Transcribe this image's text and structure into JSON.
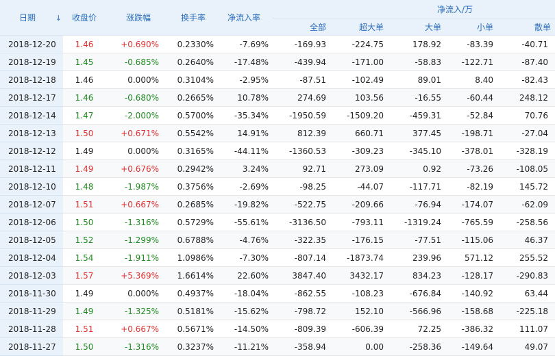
{
  "header": {
    "date": "日期",
    "sort_icon": "↓",
    "close": "收盘价",
    "change": "涨跌幅",
    "turnover": "换手率",
    "net_ratio": "净流入率",
    "flow_group": "净流入/万",
    "total": "全部",
    "xl": "超大单",
    "large": "大单",
    "small": "小单",
    "retail": "散单"
  },
  "colors": {
    "up": "#e03030",
    "down": "#1f8a1f",
    "header_text": "#2a6dbd",
    "header_bg": "#e9f2fb"
  },
  "rows": [
    {
      "date": "2018-12-20",
      "close": "1.46",
      "change": "+0.690%",
      "dir": "up",
      "turnover": "0.2330%",
      "net_ratio": "-7.69%",
      "total": "-169.93",
      "xl": "-224.75",
      "large": "178.92",
      "small": "-83.39",
      "retail": "-40.71"
    },
    {
      "date": "2018-12-19",
      "close": "1.45",
      "change": "-0.685%",
      "dir": "down",
      "turnover": "0.2640%",
      "net_ratio": "-17.48%",
      "total": "-439.94",
      "xl": "-171.00",
      "large": "-58.83",
      "small": "-122.71",
      "retail": "-87.40"
    },
    {
      "date": "2018-12-18",
      "close": "1.46",
      "change": "0.000%",
      "dir": "flat",
      "turnover": "0.3104%",
      "net_ratio": "-2.95%",
      "total": "-87.51",
      "xl": "-102.49",
      "large": "89.01",
      "small": "8.40",
      "retail": "-82.43"
    },
    {
      "date": "2018-12-17",
      "close": "1.46",
      "change": "-0.680%",
      "dir": "down",
      "turnover": "0.2665%",
      "net_ratio": "10.78%",
      "total": "274.69",
      "xl": "103.56",
      "large": "-16.55",
      "small": "-60.44",
      "retail": "248.12"
    },
    {
      "date": "2018-12-14",
      "close": "1.47",
      "change": "-2.000%",
      "dir": "down",
      "turnover": "0.5700%",
      "net_ratio": "-35.34%",
      "total": "-1950.59",
      "xl": "-1509.20",
      "large": "-459.31",
      "small": "-52.84",
      "retail": "70.76"
    },
    {
      "date": "2018-12-13",
      "close": "1.50",
      "change": "+0.671%",
      "dir": "up",
      "turnover": "0.5542%",
      "net_ratio": "14.91%",
      "total": "812.39",
      "xl": "660.71",
      "large": "377.45",
      "small": "-198.71",
      "retail": "-27.04"
    },
    {
      "date": "2018-12-12",
      "close": "1.49",
      "change": "0.000%",
      "dir": "flat",
      "turnover": "0.3165%",
      "net_ratio": "-44.11%",
      "total": "-1360.53",
      "xl": "-309.23",
      "large": "-345.10",
      "small": "-378.01",
      "retail": "-328.19"
    },
    {
      "date": "2018-12-11",
      "close": "1.49",
      "change": "+0.676%",
      "dir": "up",
      "turnover": "0.2942%",
      "net_ratio": "3.24%",
      "total": "92.71",
      "xl": "273.09",
      "large": "0.92",
      "small": "-73.26",
      "retail": "-108.05"
    },
    {
      "date": "2018-12-10",
      "close": "1.48",
      "change": "-1.987%",
      "dir": "down",
      "turnover": "0.3756%",
      "net_ratio": "-2.69%",
      "total": "-98.25",
      "xl": "-44.07",
      "large": "-117.71",
      "small": "-82.19",
      "retail": "145.72"
    },
    {
      "date": "2018-12-07",
      "close": "1.51",
      "change": "+0.667%",
      "dir": "up",
      "turnover": "0.2685%",
      "net_ratio": "-19.82%",
      "total": "-522.75",
      "xl": "-209.66",
      "large": "-76.94",
      "small": "-174.07",
      "retail": "-62.09"
    },
    {
      "date": "2018-12-06",
      "close": "1.50",
      "change": "-1.316%",
      "dir": "down",
      "turnover": "0.5729%",
      "net_ratio": "-55.61%",
      "total": "-3136.50",
      "xl": "-793.11",
      "large": "-1319.24",
      "small": "-765.59",
      "retail": "-258.56"
    },
    {
      "date": "2018-12-05",
      "close": "1.52",
      "change": "-1.299%",
      "dir": "down",
      "turnover": "0.6788%",
      "net_ratio": "-4.76%",
      "total": "-322.35",
      "xl": "-176.15",
      "large": "-77.51",
      "small": "-115.06",
      "retail": "46.37"
    },
    {
      "date": "2018-12-04",
      "close": "1.54",
      "change": "-1.911%",
      "dir": "down",
      "turnover": "1.0986%",
      "net_ratio": "-7.30%",
      "total": "-807.14",
      "xl": "-1873.74",
      "large": "239.96",
      "small": "571.12",
      "retail": "255.52"
    },
    {
      "date": "2018-12-03",
      "close": "1.57",
      "change": "+5.369%",
      "dir": "up",
      "turnover": "1.6614%",
      "net_ratio": "22.60%",
      "total": "3847.40",
      "xl": "3432.17",
      "large": "834.23",
      "small": "-128.17",
      "retail": "-290.83"
    },
    {
      "date": "2018-11-30",
      "close": "1.49",
      "change": "0.000%",
      "dir": "flat",
      "turnover": "0.4937%",
      "net_ratio": "-18.04%",
      "total": "-862.55",
      "xl": "-108.23",
      "large": "-676.84",
      "small": "-140.92",
      "retail": "63.44"
    },
    {
      "date": "2018-11-29",
      "close": "1.49",
      "change": "-1.325%",
      "dir": "down",
      "turnover": "0.5181%",
      "net_ratio": "-15.62%",
      "total": "-798.72",
      "xl": "152.10",
      "large": "-566.96",
      "small": "-158.68",
      "retail": "-225.18"
    },
    {
      "date": "2018-11-28",
      "close": "1.51",
      "change": "+0.667%",
      "dir": "up",
      "turnover": "0.5671%",
      "net_ratio": "-14.50%",
      "total": "-809.39",
      "xl": "-606.39",
      "large": "72.25",
      "small": "-386.32",
      "retail": "111.07"
    },
    {
      "date": "2018-11-27",
      "close": "1.50",
      "change": "-1.316%",
      "dir": "down",
      "turnover": "0.3237%",
      "net_ratio": "-11.21%",
      "total": "-358.94",
      "xl": "0.00",
      "large": "-258.36",
      "small": "-149.64",
      "retail": "49.07"
    }
  ]
}
